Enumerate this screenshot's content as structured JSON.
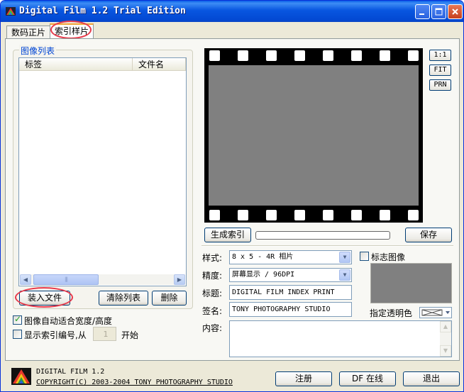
{
  "window": {
    "title": "Digital Film 1.2 Trial Edition",
    "controls": {
      "minimize_icon": "minimize-icon",
      "maximize_icon": "maximize-icon",
      "close_icon": "close-icon"
    }
  },
  "tabs": [
    {
      "label": "数码正片",
      "active": false
    },
    {
      "label": "索引样片",
      "active": true
    }
  ],
  "image_list": {
    "group_title": "图像列表",
    "columns": [
      "标签",
      "文件名"
    ],
    "rows": [],
    "load_button": "装入文件",
    "clear_button": "清除列表",
    "delete_button": "删除"
  },
  "options": {
    "auto_fit_label": "图像自动适合宽度/高度",
    "auto_fit_checked": true,
    "show_index_label": "显示索引编号,从",
    "show_index_checked": false,
    "index_start_value": "1",
    "index_start_suffix": "开始"
  },
  "preview": {
    "zoom_buttons": [
      "1:1",
      "FIT",
      "PRN"
    ],
    "generate_button": "生成索引",
    "progress": 0,
    "save_button": "保存"
  },
  "settings": {
    "style_label": "样式:",
    "style_value": "8 x 5 - 4R 相片",
    "precision_label": "精度:",
    "precision_value": "屏幕显示 / 96DPI",
    "title_label": "标题:",
    "title_value": "DIGITAL FILM INDEX PRINT",
    "signature_label": "签名:",
    "signature_value": "TONY PHOTOGRAPHY STUDIO",
    "content_label": "内容:",
    "content_value": "",
    "logo_label": "标志图像",
    "logo_checked": false,
    "transparent_label": "指定透明色"
  },
  "footer": {
    "product_name": "DIGITAL FILM 1.2",
    "copyright": "COPYRIGHT(C) 2003-2004 TONY PHOTOGRAPHY STUDIO",
    "register_button": "注册",
    "online_button": "DF 在线",
    "exit_button": "退出"
  },
  "colors": {
    "title_bar": "#0a5ee8",
    "frame_gray": "#808080",
    "annotation_red": "#e8394a",
    "group_title_blue": "#0046d5"
  }
}
